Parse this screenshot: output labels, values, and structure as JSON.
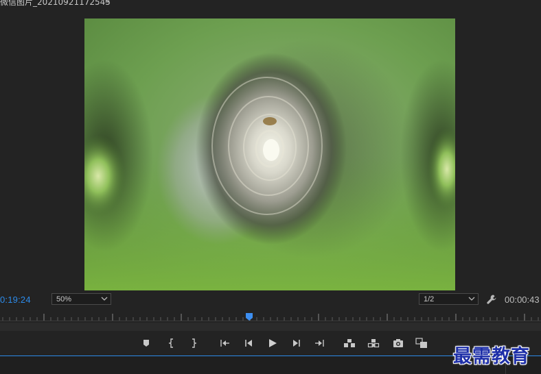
{
  "title_bar": {
    "clip_name": "微信图片_20210921172545",
    "menu_glyph": "≡"
  },
  "controls": {
    "timecode_current": "0:19:24",
    "zoom_value": "50%",
    "resolution_value": "1/2",
    "timecode_duration": "00:00:43"
  },
  "playback": {
    "playhead_fraction": 0.461
  },
  "transport_buttons": [
    {
      "name": "add-marker-button",
      "icon": "marker-icon"
    },
    {
      "name": "mark-in-button",
      "icon": "mark-in-icon"
    },
    {
      "name": "mark-out-button",
      "icon": "mark-out-icon"
    },
    {
      "name": "go-to-in-button",
      "icon": "go-to-in-icon"
    },
    {
      "name": "step-back-button",
      "icon": "step-back-icon"
    },
    {
      "name": "play-button",
      "icon": "play-icon"
    },
    {
      "name": "step-forward-button",
      "icon": "step-forward-icon"
    },
    {
      "name": "go-to-out-button",
      "icon": "go-to-out-icon"
    },
    {
      "name": "insert-button",
      "icon": "insert-icon"
    },
    {
      "name": "overwrite-button",
      "icon": "overwrite-icon"
    },
    {
      "name": "export-frame-button",
      "icon": "camera-icon"
    },
    {
      "name": "compare-view-button",
      "icon": "compare-icon"
    }
  ],
  "watermark": {
    "text": "最需教育"
  },
  "colors": {
    "panel_bg": "#232323",
    "accent_blue": "#2d8ceb",
    "watermark_blue": "#1e2fa8"
  }
}
